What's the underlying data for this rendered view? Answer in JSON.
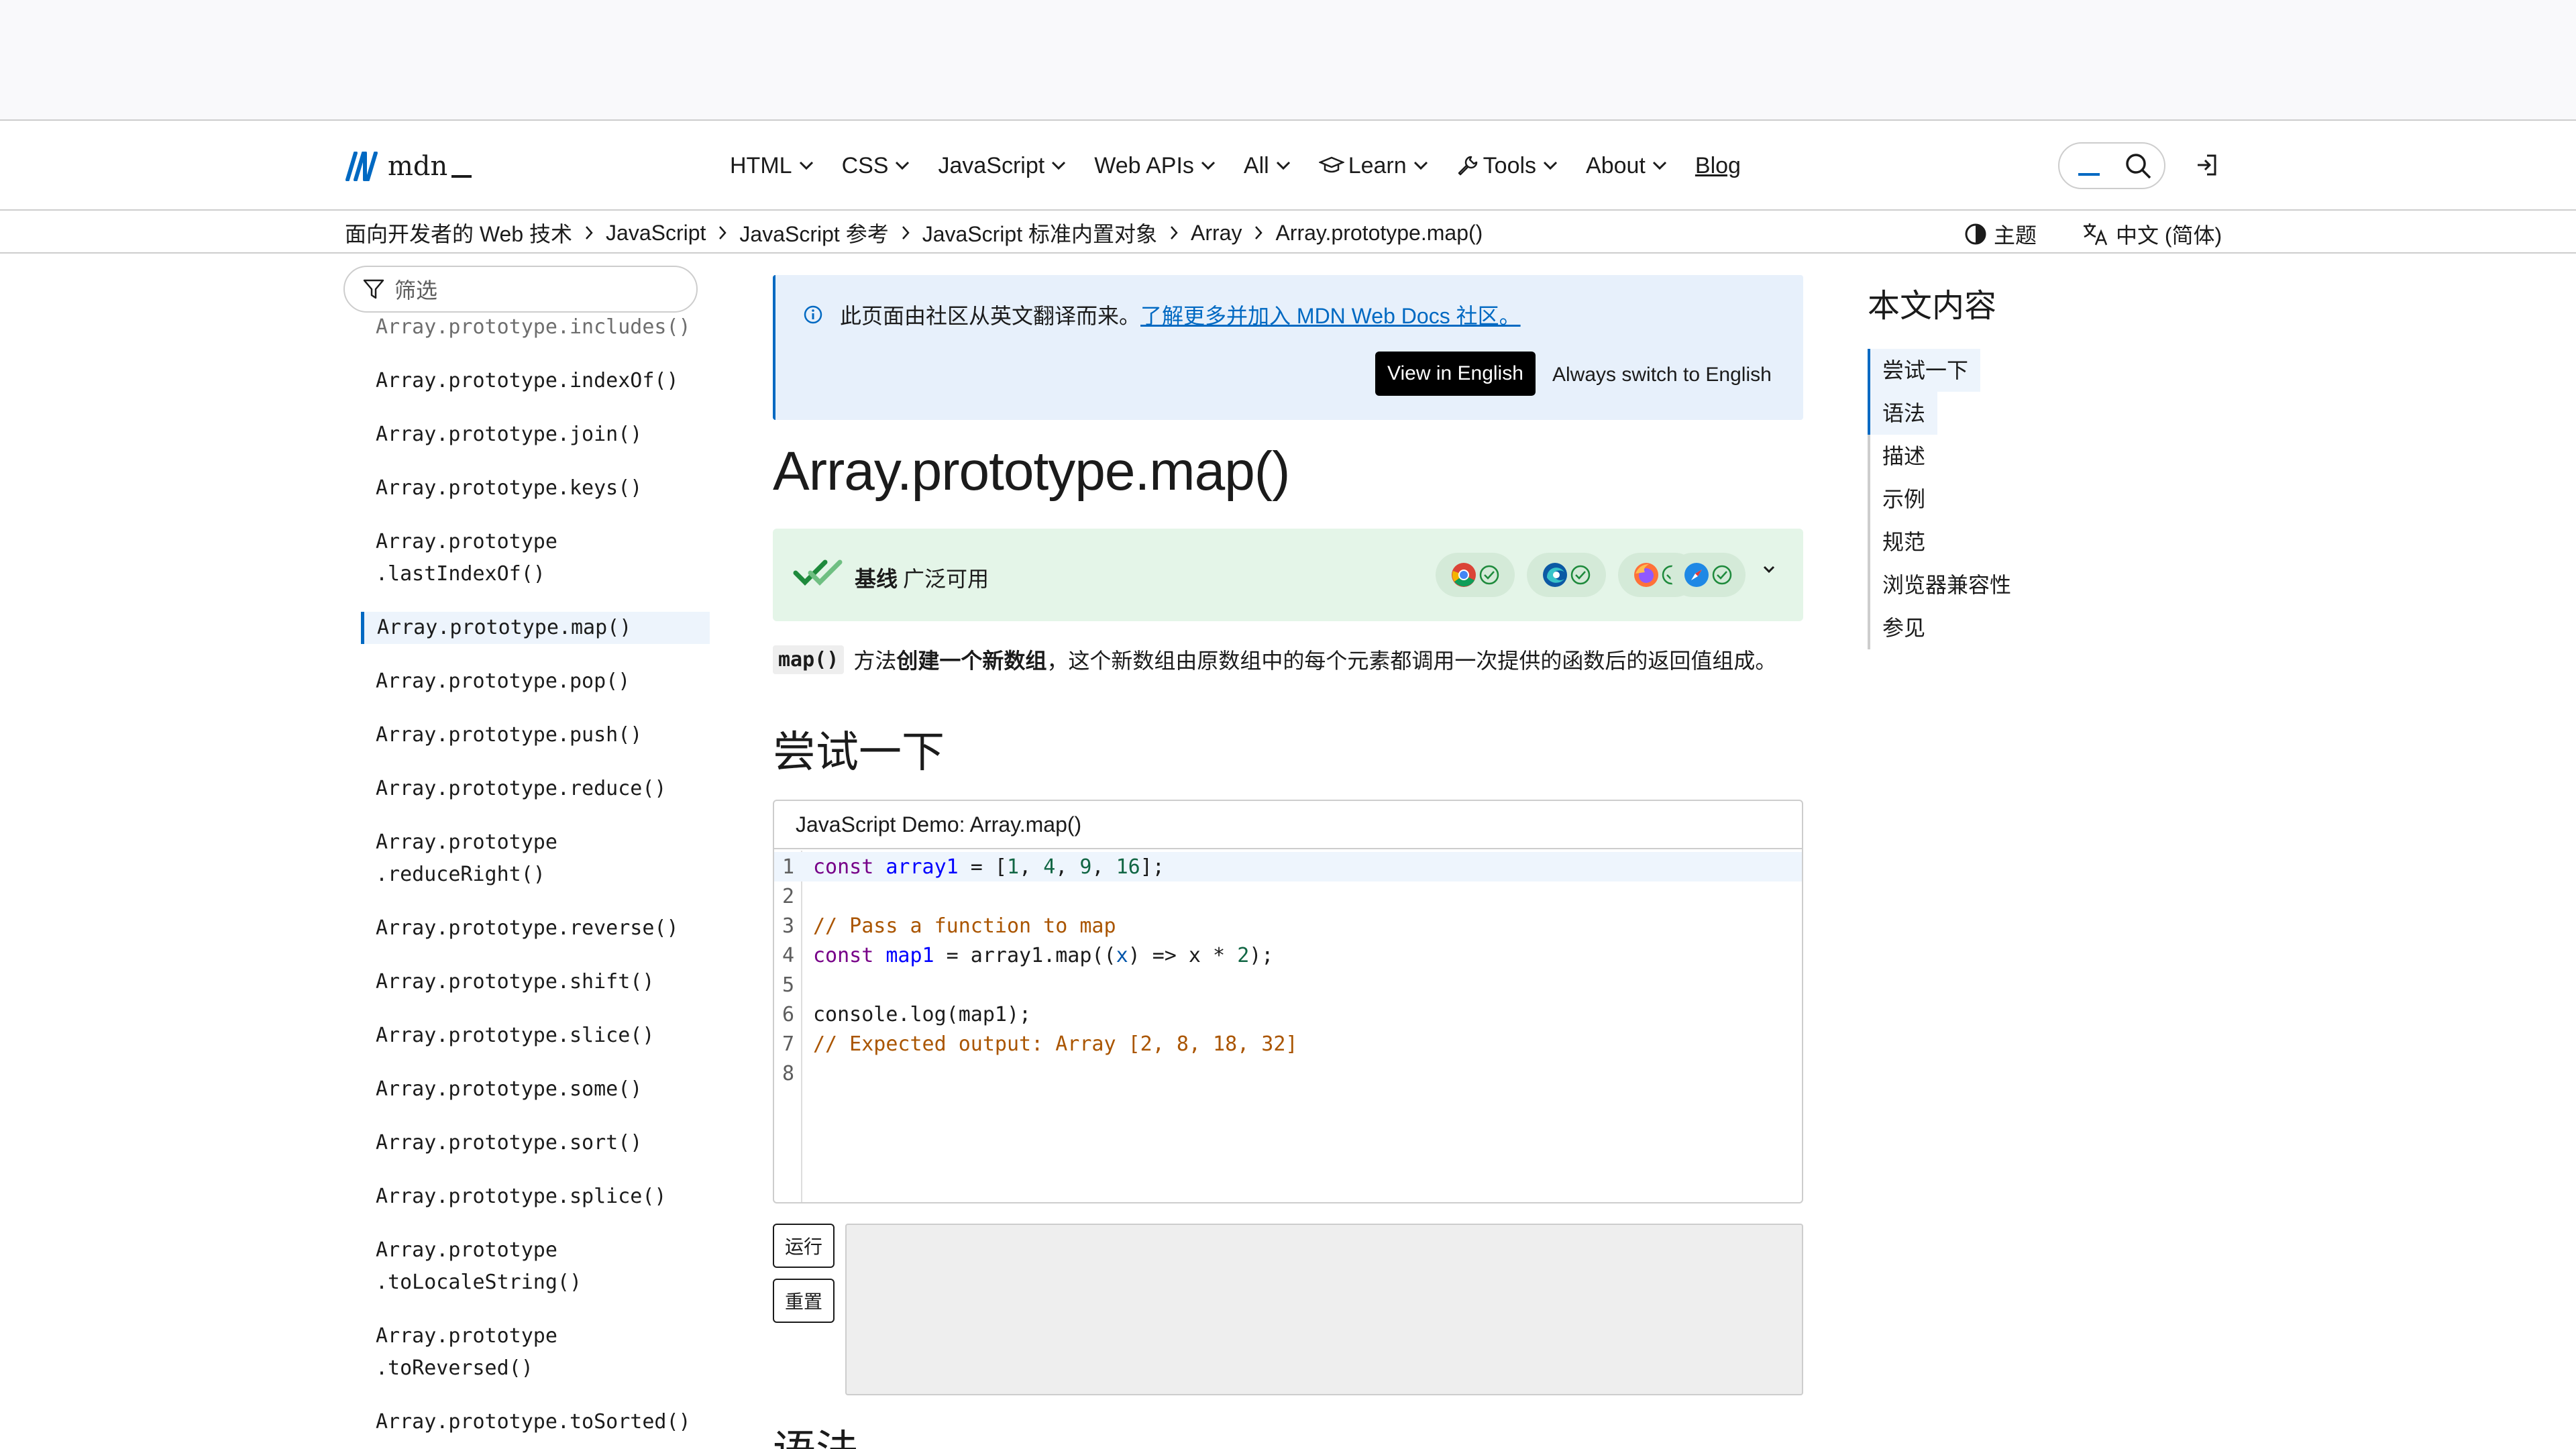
{
  "header": {
    "logo_text": "mdn",
    "nav": [
      {
        "label": "HTML",
        "icon": "chevron-down-icon"
      },
      {
        "label": "CSS",
        "icon": "chevron-down-icon"
      },
      {
        "label": "JavaScript",
        "icon": "chevron-down-icon"
      },
      {
        "label": "Web APIs",
        "icon": "chevron-down-icon"
      },
      {
        "label": "All",
        "icon": "chevron-down-icon"
      },
      {
        "label": "Learn",
        "icon": "chevron-down-icon",
        "lead_icon": "graduation-cap-icon"
      },
      {
        "label": "Tools",
        "icon": "chevron-down-icon",
        "lead_icon": "wrench-icon"
      },
      {
        "label": "About",
        "icon": "chevron-down-icon"
      }
    ],
    "blog": "Blog"
  },
  "breadcrumb": [
    "面向开发者的 Web 技术",
    "JavaScript",
    "JavaScript 参考",
    "JavaScript 标准内置对象",
    "Array",
    "Array.prototype.map()"
  ],
  "theme_label": "主题",
  "language_label": "中文 (简体)",
  "sidebar": {
    "filter_placeholder": "筛选",
    "items": [
      {
        "label": "Array.prototype.includes()",
        "state": "faded"
      },
      {
        "label": "Array.prototype.indexOf()"
      },
      {
        "label": "Array.prototype.join()"
      },
      {
        "label": "Array.prototype.keys()"
      },
      {
        "label": "Array.prototype\n.lastIndexOf()"
      },
      {
        "label": "Array.prototype.map()",
        "state": "active"
      },
      {
        "label": "Array.prototype.pop()"
      },
      {
        "label": "Array.prototype.push()"
      },
      {
        "label": "Array.prototype.reduce()"
      },
      {
        "label": "Array.prototype\n.reduceRight()"
      },
      {
        "label": "Array.prototype.reverse()"
      },
      {
        "label": "Array.prototype.shift()"
      },
      {
        "label": "Array.prototype.slice()"
      },
      {
        "label": "Array.prototype.some()"
      },
      {
        "label": "Array.prototype.sort()"
      },
      {
        "label": "Array.prototype.splice()"
      },
      {
        "label": "Array.prototype\n.toLocaleString()"
      },
      {
        "label": "Array.prototype\n.toReversed()"
      },
      {
        "label": "Array.prototype.toSorted()"
      }
    ]
  },
  "notice": {
    "text": "此页面由社区从英文翻译而来。",
    "link": "了解更多并加入 MDN Web Docs 社区。",
    "view_english": "View in English",
    "always_english": "Always switch to English"
  },
  "title": "Array.prototype.map()",
  "baseline": {
    "bold": "基线",
    "text": "广泛可用",
    "browsers": [
      "chrome-icon",
      "edge-icon",
      "firefox-icon",
      "safari-icon"
    ]
  },
  "intro": {
    "code": "map()",
    "pre": "方法",
    "bold": "创建一个新数组",
    "post": "，这个新数组由原数组中的每个元素都调用一次提供的函数后的返回值组成。"
  },
  "try_heading": "尝试一下",
  "demo": {
    "title": "JavaScript Demo: Array.map()",
    "lines": [
      "1",
      "2",
      "3",
      "4",
      "5",
      "6",
      "7",
      "8"
    ],
    "code": {
      "l1_kw": "const",
      "l1_def": "array1",
      "l1_rest_a": " = [",
      "n1": "1",
      "n2": "4",
      "n3": "9",
      "n4": "16",
      "l1_end": "];",
      "l3_comment": "// Pass a function to map",
      "l4_kw": "const",
      "l4_def": "map1",
      "l4_rest": " = array1.map((",
      "l4_x": "x",
      "l4_mid": ") => x * ",
      "l4_num": "2",
      "l4_end": ");",
      "l6": "console.log(map1);",
      "l7_comment": "// Expected output: Array [2, 8, 18, 32]"
    },
    "run": "运行",
    "reset": "重置"
  },
  "syntax_heading": "语法",
  "toc": {
    "title": "本文内容",
    "items": [
      "尝试一下",
      "语法",
      "描述",
      "示例",
      "规范",
      "浏览器兼容性",
      "参见"
    ]
  }
}
